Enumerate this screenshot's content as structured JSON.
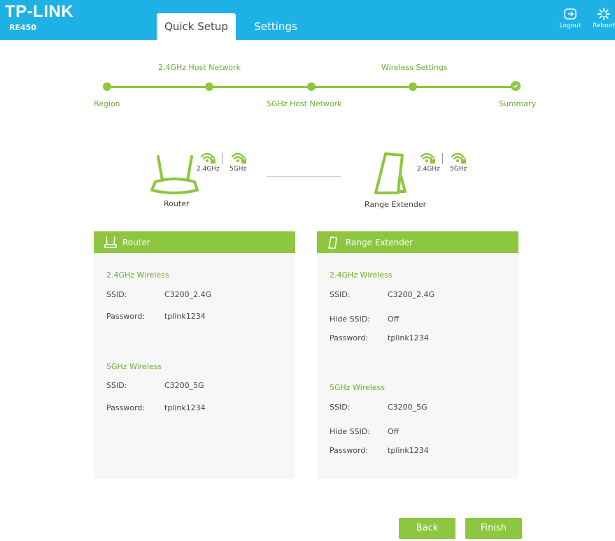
{
  "header": {
    "logo": "TP-LINK",
    "model": "RE450",
    "tabs": [
      {
        "label": "Quick Setup",
        "active": true
      },
      {
        "label": "Settings",
        "active": false
      }
    ],
    "logout_label": "Logout",
    "reboot_label": "Reboot"
  },
  "steps": [
    "Region",
    "2.4GHz Host Network",
    "5GHz Host Network",
    "Wireless Settings",
    "Summary"
  ],
  "diagram": {
    "router_label": "Router",
    "extender_label": "Range Extender",
    "band_24": "2.4GHz",
    "band_5": "5GHz"
  },
  "router_panel": {
    "title": "Router",
    "w24_title": "2.4GHz Wireless",
    "w24_ssid_label": "SSID:",
    "w24_ssid": "C3200_2.4G",
    "w24_pass_label": "Password:",
    "w24_pass": "tplink1234",
    "w5_title": "5GHz Wireless",
    "w5_ssid_label": "SSID:",
    "w5_ssid": "C3200_5G",
    "w5_pass_label": "Password:",
    "w5_pass": "tplink1234"
  },
  "extender_panel": {
    "title": "Range Extender",
    "w24_title": "2.4GHz Wireless",
    "w24_ssid_label": "SSID:",
    "w24_ssid": "C3200_2.4G",
    "w24_hide_label": "Hide SSID:",
    "w24_hide": "Off",
    "w24_pass_label": "Password:",
    "w24_pass": "tplink1234",
    "w5_title": "5GHz Wireless",
    "w5_ssid_label": "SSID:",
    "w5_ssid": "C3200_5G",
    "w5_hide_label": "Hide SSID:",
    "w5_hide": "Off",
    "w5_pass_label": "Password:",
    "w5_pass": "tplink1234"
  },
  "buttons": {
    "back": "Back",
    "finish": "Finish"
  },
  "colors": {
    "header": "#1eb1e6",
    "accent": "#8dc63f",
    "accent_text": "#6aac2d"
  }
}
